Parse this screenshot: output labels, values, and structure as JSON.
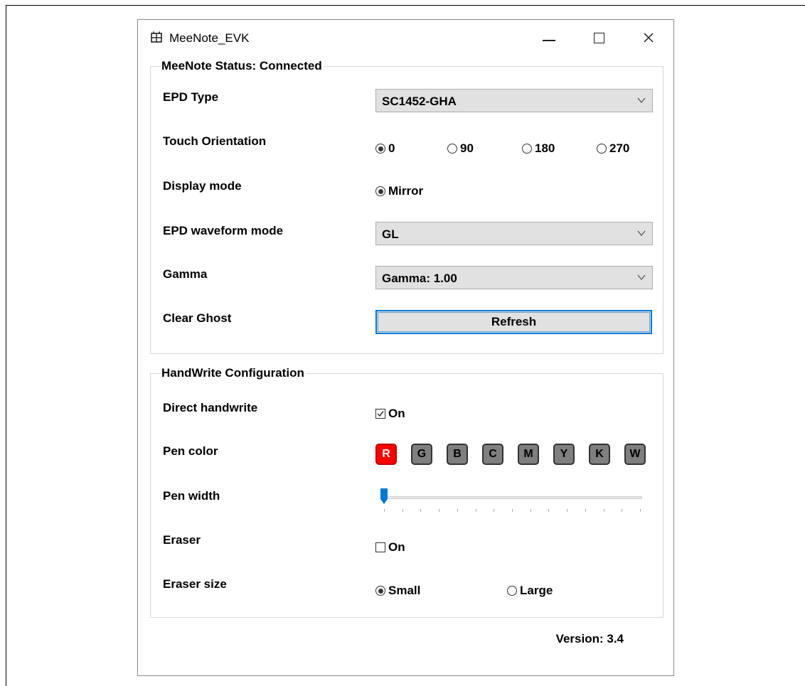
{
  "window": {
    "title": "MeeNote_EVK",
    "controls": {
      "minimize": "minimize",
      "maximize": "maximize",
      "close": "close"
    }
  },
  "status_group": {
    "legend": "MeeNote Status: Connected",
    "epd_type": {
      "label": "EPD Type",
      "value": "SC1452-GHA"
    },
    "touch_orientation": {
      "label": "Touch Orientation",
      "options": [
        "0",
        "90",
        "180",
        "270"
      ],
      "selected": "0"
    },
    "display_mode": {
      "label": "Display mode",
      "option": "Mirror",
      "selected": true
    },
    "waveform": {
      "label": "EPD waveform mode",
      "value": "GL"
    },
    "gamma": {
      "label": "Gamma",
      "value": "Gamma: 1.00"
    },
    "clear_ghost": {
      "label": "Clear Ghost",
      "button": "Refresh"
    }
  },
  "handwrite_group": {
    "legend": "HandWrite Configuration",
    "direct_handwrite": {
      "label": "Direct handwrite",
      "check_label": "On",
      "checked": true
    },
    "pen_color": {
      "label": "Pen color",
      "options": [
        "R",
        "G",
        "B",
        "C",
        "M",
        "Y",
        "K",
        "W"
      ],
      "selected": "R",
      "selected_color": "#ff0000",
      "unselected_color": "#7f7f7f"
    },
    "pen_width": {
      "label": "Pen width",
      "value_fraction": 0.0
    },
    "eraser": {
      "label": "Eraser",
      "check_label": "On",
      "checked": false
    },
    "eraser_size": {
      "label": "Eraser size",
      "options": [
        "Small",
        "Large"
      ],
      "selected": "Small"
    }
  },
  "version": "Version: 3.4",
  "colors": {
    "accent": "#0078d7"
  }
}
